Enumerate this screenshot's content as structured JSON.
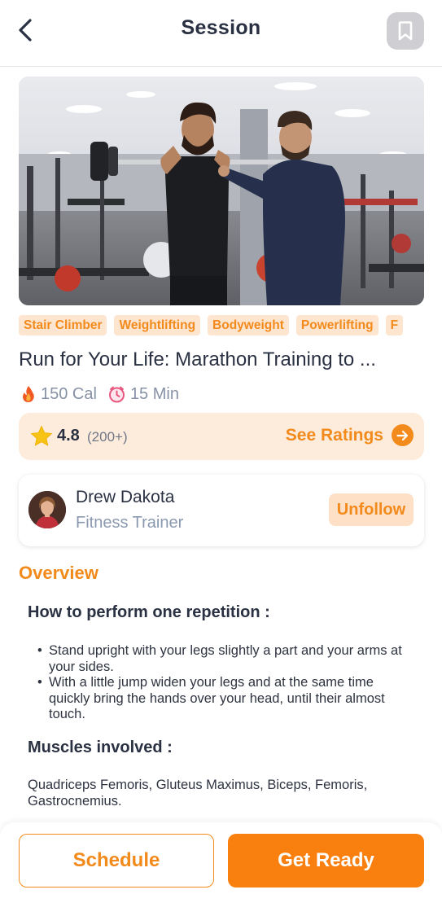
{
  "header": {
    "title": "Session",
    "back_icon": "chevron-left-icon",
    "bookmark_icon": "bookmark-icon"
  },
  "hero": {
    "image": "gym-trainer-photo"
  },
  "tags": [
    "Stair Climber",
    "Weightlifting",
    "Bodyweight",
    "Powerlifting",
    "F"
  ],
  "session": {
    "title": "Run for Your Life: Marathon Training to ...",
    "calories": "150 Cal",
    "duration": "15 Min",
    "calories_icon": "flame-icon",
    "duration_icon": "clock-icon"
  },
  "rating": {
    "value": "4.8",
    "count": "(200+)",
    "see_label": "See Ratings",
    "star_icon": "star-icon",
    "arrow_icon": "arrow-right-circle-icon"
  },
  "trainer": {
    "name": "Drew Dakota",
    "role": "Fitness Trainer",
    "unfollow_label": "Unfollow"
  },
  "overview": {
    "title": "Overview",
    "repetition_heading": "How to perform one repetition :",
    "steps": [
      "Stand upright with your legs slightly a part and your arms at your sides.",
      "With a little jump widen your legs and at the same time quickly bring the hands over your head, until their almost touch."
    ],
    "muscles_heading": "Muscles involved :",
    "muscles": "Quadriceps Femoris, Gluteus Maximus, Biceps, Femoris, Gastrocnemius."
  },
  "actions": {
    "schedule_label": "Schedule",
    "ready_label": "Get Ready"
  },
  "colors": {
    "accent": "#f9800e",
    "accent_text": "#f28a1c",
    "tag_bg": "#fde5cf",
    "rating_bg": "#fdecdc",
    "heading": "#2a3142"
  }
}
